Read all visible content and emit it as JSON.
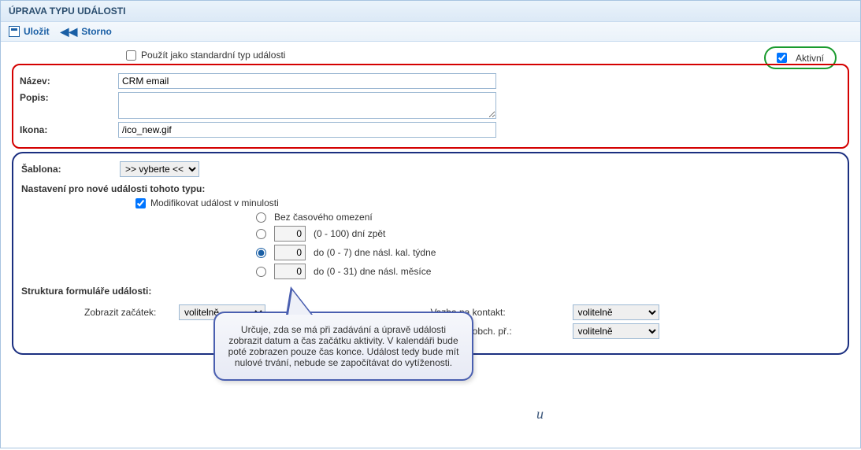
{
  "header": {
    "title": "ÚPRAVA TYPU UDÁLOSTI"
  },
  "toolbar": {
    "save": "Uložit",
    "cancel": "Storno"
  },
  "std": {
    "label": "Použít jako standardní typ události"
  },
  "active": {
    "label": "Aktivní"
  },
  "fields": {
    "name_label": "Název:",
    "name_value": "CRM email",
    "desc_label": "Popis:",
    "desc_value": "",
    "icon_label": "Ikona:",
    "icon_value": "/ico_new.gif",
    "template_label": "Šablona:",
    "template_value": ">> vyberte <<"
  },
  "settings": {
    "title": "Nastavení pro nové události tohoto typu:",
    "modify_past": "Modifikovat událost v minulosti",
    "opt_none": "Bez časového omezení",
    "opt_days_val": "0",
    "opt_days_label": "(0 - 100) dní zpět",
    "opt_week_val": "0",
    "opt_week_label": "do (0 - 7) dne násl. kal. týdne",
    "opt_month_val": "0",
    "opt_month_label": "do (0 - 31) dne násl. měsíce"
  },
  "structure": {
    "title": "Struktura formuláře události:",
    "show_start": "Zobrazit začátek:",
    "contact": "Vazba na kontakt:",
    "deal": "Vazba na obch. př.:",
    "optional": "volitelně"
  },
  "callout": {
    "text": "Určuje, zda se má při zadávání a úpravě události zobrazit datum a čas začátku aktivity. V kalendáři bude poté zobrazen pouze čas konce. Událost tedy bude mít nulové trvání, nebude se započítávat do vytíženosti."
  }
}
